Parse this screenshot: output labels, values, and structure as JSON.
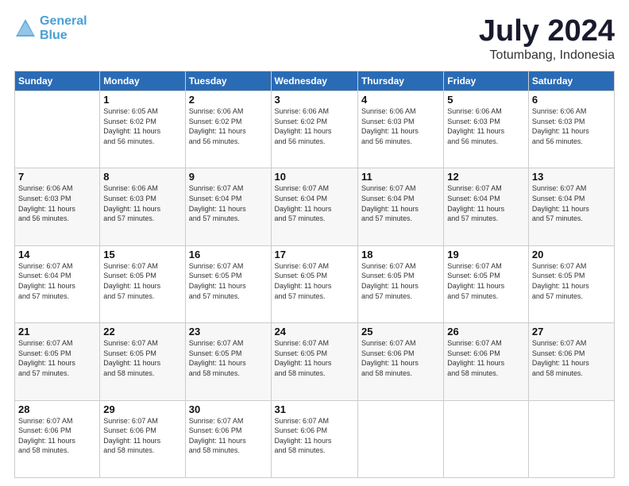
{
  "logo": {
    "line1": "General",
    "line2": "Blue"
  },
  "title": "July 2024",
  "subtitle": "Totumbang, Indonesia",
  "days_header": [
    "Sunday",
    "Monday",
    "Tuesday",
    "Wednesday",
    "Thursday",
    "Friday",
    "Saturday"
  ],
  "weeks": [
    [
      {
        "day": "",
        "info": ""
      },
      {
        "day": "1",
        "info": "Sunrise: 6:05 AM\nSunset: 6:02 PM\nDaylight: 11 hours\nand 56 minutes."
      },
      {
        "day": "2",
        "info": "Sunrise: 6:06 AM\nSunset: 6:02 PM\nDaylight: 11 hours\nand 56 minutes."
      },
      {
        "day": "3",
        "info": "Sunrise: 6:06 AM\nSunset: 6:02 PM\nDaylight: 11 hours\nand 56 minutes."
      },
      {
        "day": "4",
        "info": "Sunrise: 6:06 AM\nSunset: 6:03 PM\nDaylight: 11 hours\nand 56 minutes."
      },
      {
        "day": "5",
        "info": "Sunrise: 6:06 AM\nSunset: 6:03 PM\nDaylight: 11 hours\nand 56 minutes."
      },
      {
        "day": "6",
        "info": "Sunrise: 6:06 AM\nSunset: 6:03 PM\nDaylight: 11 hours\nand 56 minutes."
      }
    ],
    [
      {
        "day": "7",
        "info": "Sunrise: 6:06 AM\nSunset: 6:03 PM\nDaylight: 11 hours\nand 56 minutes."
      },
      {
        "day": "8",
        "info": "Sunrise: 6:06 AM\nSunset: 6:03 PM\nDaylight: 11 hours\nand 57 minutes."
      },
      {
        "day": "9",
        "info": "Sunrise: 6:07 AM\nSunset: 6:04 PM\nDaylight: 11 hours\nand 57 minutes."
      },
      {
        "day": "10",
        "info": "Sunrise: 6:07 AM\nSunset: 6:04 PM\nDaylight: 11 hours\nand 57 minutes."
      },
      {
        "day": "11",
        "info": "Sunrise: 6:07 AM\nSunset: 6:04 PM\nDaylight: 11 hours\nand 57 minutes."
      },
      {
        "day": "12",
        "info": "Sunrise: 6:07 AM\nSunset: 6:04 PM\nDaylight: 11 hours\nand 57 minutes."
      },
      {
        "day": "13",
        "info": "Sunrise: 6:07 AM\nSunset: 6:04 PM\nDaylight: 11 hours\nand 57 minutes."
      }
    ],
    [
      {
        "day": "14",
        "info": "Sunrise: 6:07 AM\nSunset: 6:04 PM\nDaylight: 11 hours\nand 57 minutes."
      },
      {
        "day": "15",
        "info": "Sunrise: 6:07 AM\nSunset: 6:05 PM\nDaylight: 11 hours\nand 57 minutes."
      },
      {
        "day": "16",
        "info": "Sunrise: 6:07 AM\nSunset: 6:05 PM\nDaylight: 11 hours\nand 57 minutes."
      },
      {
        "day": "17",
        "info": "Sunrise: 6:07 AM\nSunset: 6:05 PM\nDaylight: 11 hours\nand 57 minutes."
      },
      {
        "day": "18",
        "info": "Sunrise: 6:07 AM\nSunset: 6:05 PM\nDaylight: 11 hours\nand 57 minutes."
      },
      {
        "day": "19",
        "info": "Sunrise: 6:07 AM\nSunset: 6:05 PM\nDaylight: 11 hours\nand 57 minutes."
      },
      {
        "day": "20",
        "info": "Sunrise: 6:07 AM\nSunset: 6:05 PM\nDaylight: 11 hours\nand 57 minutes."
      }
    ],
    [
      {
        "day": "21",
        "info": "Sunrise: 6:07 AM\nSunset: 6:05 PM\nDaylight: 11 hours\nand 57 minutes."
      },
      {
        "day": "22",
        "info": "Sunrise: 6:07 AM\nSunset: 6:05 PM\nDaylight: 11 hours\nand 58 minutes."
      },
      {
        "day": "23",
        "info": "Sunrise: 6:07 AM\nSunset: 6:05 PM\nDaylight: 11 hours\nand 58 minutes."
      },
      {
        "day": "24",
        "info": "Sunrise: 6:07 AM\nSunset: 6:05 PM\nDaylight: 11 hours\nand 58 minutes."
      },
      {
        "day": "25",
        "info": "Sunrise: 6:07 AM\nSunset: 6:06 PM\nDaylight: 11 hours\nand 58 minutes."
      },
      {
        "day": "26",
        "info": "Sunrise: 6:07 AM\nSunset: 6:06 PM\nDaylight: 11 hours\nand 58 minutes."
      },
      {
        "day": "27",
        "info": "Sunrise: 6:07 AM\nSunset: 6:06 PM\nDaylight: 11 hours\nand 58 minutes."
      }
    ],
    [
      {
        "day": "28",
        "info": "Sunrise: 6:07 AM\nSunset: 6:06 PM\nDaylight: 11 hours\nand 58 minutes."
      },
      {
        "day": "29",
        "info": "Sunrise: 6:07 AM\nSunset: 6:06 PM\nDaylight: 11 hours\nand 58 minutes."
      },
      {
        "day": "30",
        "info": "Sunrise: 6:07 AM\nSunset: 6:06 PM\nDaylight: 11 hours\nand 58 minutes."
      },
      {
        "day": "31",
        "info": "Sunrise: 6:07 AM\nSunset: 6:06 PM\nDaylight: 11 hours\nand 58 minutes."
      },
      {
        "day": "",
        "info": ""
      },
      {
        "day": "",
        "info": ""
      },
      {
        "day": "",
        "info": ""
      }
    ]
  ]
}
